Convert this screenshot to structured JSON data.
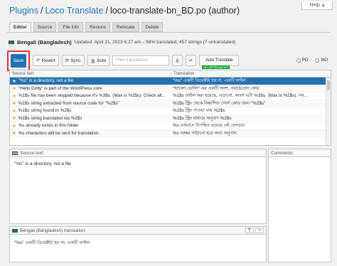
{
  "help": {
    "label": "Help"
  },
  "breadcrumb": {
    "plugins": "Plugins",
    "loco": "Loco Translate",
    "file": "loco-translate-bn_BD.po (author)"
  },
  "tabs": [
    {
      "label": "Editor"
    },
    {
      "label": "Source"
    },
    {
      "label": "File info"
    },
    {
      "label": "Restore"
    },
    {
      "label": "Relocate"
    },
    {
      "label": "Delete"
    }
  ],
  "file_info": {
    "language": "Bengali (Bangladesh)",
    "stats": "Updated: April 21, 2023 6:27 am – 98% translated, 457 strings (7 untranslated)"
  },
  "toolbar": {
    "save": "Save",
    "revert": "Revert",
    "sync": "Sync",
    "auto": "Auto",
    "filter_placeholder": "Filter translations",
    "auto_translate": "Auto Translate",
    "api_badge": "No API Required!",
    "radio_1": "PO",
    "radio_2": "MO"
  },
  "grid": {
    "col_source": "Source text",
    "col_translation": "Translation",
    "rows": [
      {
        "source": "\"%s\" is a directory, not a file",
        "translation": "\"%s\" একটি ডিরেক্টরি হয় না, একটি ফাইল"
      },
      {
        "source": "\"Hello Dolly\" is part of the WordPress core",
        "translation": "\"হ্যালো ডোলি\" এর একটি অংশ, ওয়ার্ডপ্রেস কোর"
      },
      {
        "source": "%1$s file has been skipped because it's %3$s. (Max is %2$s). Check all...",
        "translation": "%1$s ফাইল করা হয়েছে, এড়ানো, কারণ এটা %3$s. (Max is %2$s). সব..."
      },
      {
        "source": "%1$s string extracted from source code for \"%2$s\"",
        "translation": "%1$s স্ট্রিং থেকে নিষ্কাশিত সোর্স কোড জন্য \"%2$s\""
      },
      {
        "source": "%1$s string found in %2$s",
        "translation": "%1$s স্ট্রিং পাওয়া যায় %2$s"
      },
      {
        "source": "%1$s string translated via %2$s",
        "translation": "%1$s স্ট্রিং মাধ্যমে অনুবাদ %2$s"
      },
      {
        "source": "%s already exists in this folder",
        "translation": "%s বর্তমানে উপস্থিত রয়েছে এই ফোল্ডার"
      },
      {
        "source": "%s characters will be sent for translation.",
        "translation": "%s অক্ষর পাঠানো হবে জন্য অনুবাদ."
      }
    ]
  },
  "source_panel": {
    "title": "Source text:",
    "text": "\"%s\" is a directory, not a file"
  },
  "comments_panel": {
    "title": "Comments:"
  },
  "translation_panel": {
    "title": "Bengali (Bangladesh) translation:",
    "text": "\"%s\" একটি ডিরেক্টরি হয় না, একটি ফাইল"
  }
}
